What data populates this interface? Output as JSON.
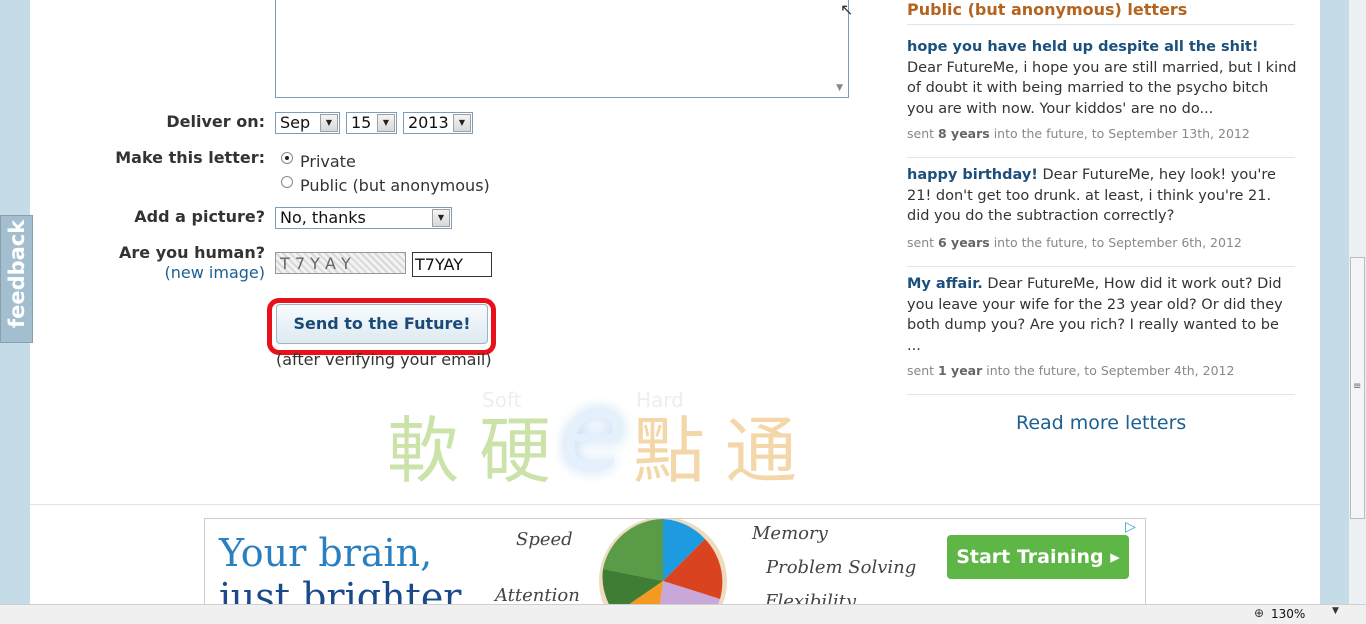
{
  "form": {
    "deliver_label": "Deliver on:",
    "month": "Sep",
    "day": "15",
    "year": "2013",
    "make_label": "Make this letter:",
    "private_label": "Private",
    "public_label": "Public (but anonymous)",
    "picture_label": "Add a picture?",
    "picture_value": "No, thanks",
    "human_label": "Are you human?",
    "new_image_link": "(new image)",
    "captcha_image_text": "T 7 Y A Y",
    "captcha_value": "T7YAY",
    "send_label": "Send to the Future!",
    "after_note": "(after verifying your email)"
  },
  "sidebar": {
    "title": "Public (but anonymous) letters",
    "letters": [
      {
        "title": "hope you have held up despite all the shit!",
        "body": " Dear FutureMe, i hope you are still married, but I kind of doubt it with being married to the psycho bitch you are with now. Your kiddos' are no do...",
        "sent": "sent ",
        "duration": "8 years",
        "into": " into the future, to September 13th, 2012"
      },
      {
        "title": "happy birthday!",
        "body": " Dear FutureMe, hey look! you're 21! don't get too drunk. at least, i think you're 21. did you do the subtraction correctly?",
        "sent": "sent ",
        "duration": "6 years",
        "into": " into the future, to September 6th, 2012"
      },
      {
        "title": "My affair.",
        "body": " Dear FutureMe, How did it work out? Did you leave your wife for the 23 year old? Or did they both dump you? Are you rich? I really wanted to be ...",
        "sent": "sent ",
        "duration": "1 year",
        "into": " into the future, to September 4th, 2012"
      }
    ],
    "read_more": "Read more letters"
  },
  "watermark": {
    "left": "軟硬",
    "e": "e",
    "right": "點通",
    "soft": "Soft",
    "hard": "Hard"
  },
  "ad": {
    "headline1": "Your brain,",
    "headline2": "just brighter",
    "words": [
      "Speed",
      "Memory",
      "Problem Solving",
      "Attention",
      "Flexibility"
    ],
    "cta": "Start Training ▸",
    "adchoices": "▷"
  },
  "chrome": {
    "feedback": "feedback",
    "zoom": "130%"
  }
}
